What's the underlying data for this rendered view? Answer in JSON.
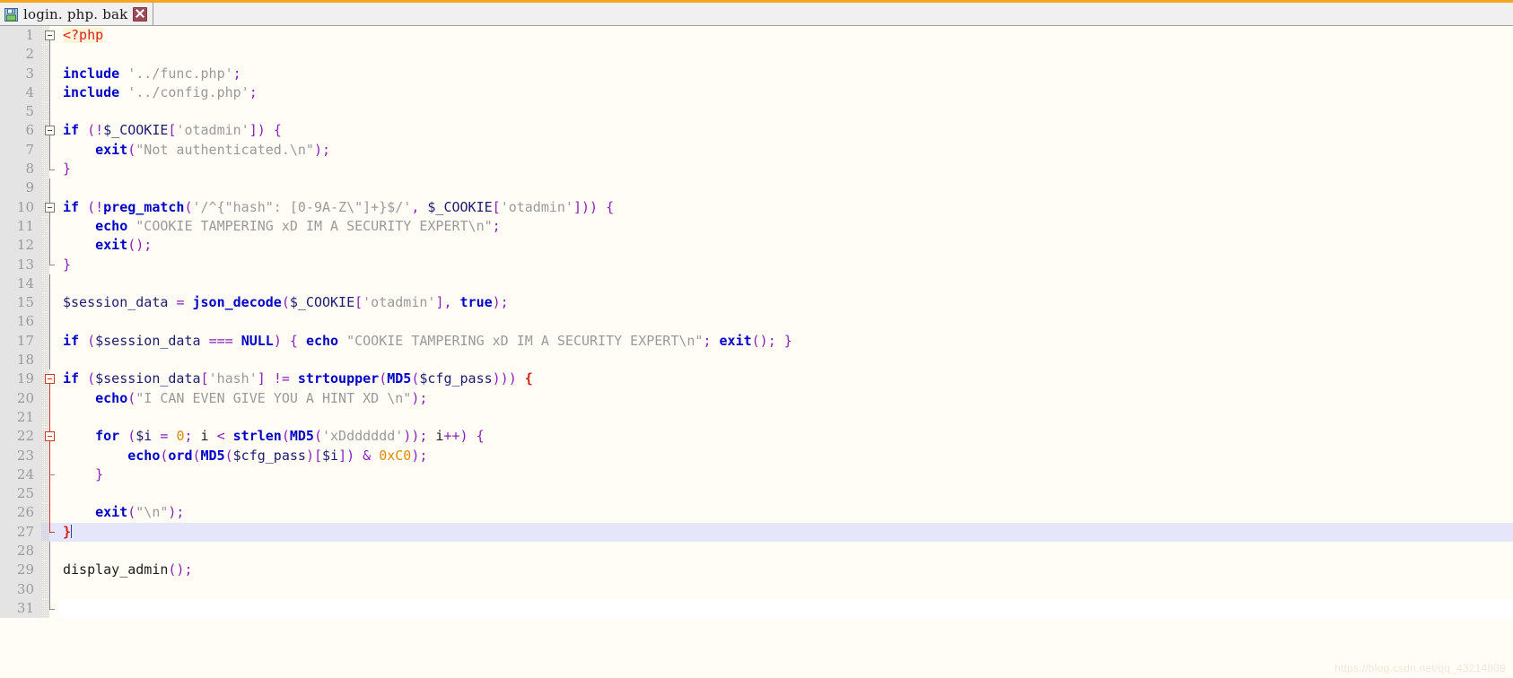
{
  "window": {
    "accent_color": "#f5a623",
    "editor_background": "#fffdf5",
    "gutter_background": "#e4e4e4",
    "current_line_highlight": "#e6e6fa"
  },
  "tab": {
    "title": "login. php. bak",
    "save_icon": "floppy-disk-icon",
    "close_icon": "close-icon"
  },
  "gutter": {
    "line_numbers": [
      "1",
      "2",
      "3",
      "4",
      "5",
      "6",
      "7",
      "8",
      "9",
      "10",
      "11",
      "12",
      "13",
      "14",
      "15",
      "16",
      "17",
      "18",
      "19",
      "20",
      "21",
      "22",
      "23",
      "24",
      "25",
      "26",
      "27",
      "28",
      "29",
      "30",
      "31"
    ]
  },
  "code": {
    "lines": [
      {
        "n": "1",
        "text": "<?php"
      },
      {
        "n": "2",
        "text": ""
      },
      {
        "n": "3",
        "text": "include '../func.php';"
      },
      {
        "n": "4",
        "text": "include '../config.php';"
      },
      {
        "n": "5",
        "text": ""
      },
      {
        "n": "6",
        "text": "if (!$_COOKIE['otadmin']) {"
      },
      {
        "n": "7",
        "text": "    exit(\"Not authenticated.\\n\");"
      },
      {
        "n": "8",
        "text": "}"
      },
      {
        "n": "9",
        "text": ""
      },
      {
        "n": "10",
        "text": "if (!preg_match('/^{\"hash\": [0-9A-Z\\\"]+}$/', $_COOKIE['otadmin'])) {"
      },
      {
        "n": "11",
        "text": "    echo \"COOKIE TAMPERING xD IM A SECURITY EXPERT\\n\";"
      },
      {
        "n": "12",
        "text": "    exit();"
      },
      {
        "n": "13",
        "text": "}"
      },
      {
        "n": "14",
        "text": ""
      },
      {
        "n": "15",
        "text": "$session_data = json_decode($_COOKIE['otadmin'], true);"
      },
      {
        "n": "16",
        "text": ""
      },
      {
        "n": "17",
        "text": "if ($session_data === NULL) { echo \"COOKIE TAMPERING xD IM A SECURITY EXPERT\\n\"; exit(); }"
      },
      {
        "n": "18",
        "text": ""
      },
      {
        "n": "19",
        "text": "if ($session_data['hash'] != strtoupper(MD5($cfg_pass))) {"
      },
      {
        "n": "20",
        "text": "    echo(\"I CAN EVEN GIVE YOU A HINT XD \\n\");"
      },
      {
        "n": "21",
        "text": ""
      },
      {
        "n": "22",
        "text": "    for ($i = 0; i < strlen(MD5('xDdddddd')); i++) {"
      },
      {
        "n": "23",
        "text": "        echo(ord(MD5($cfg_pass)[$i]) & 0xC0);"
      },
      {
        "n": "24",
        "text": "    }"
      },
      {
        "n": "25",
        "text": ""
      },
      {
        "n": "26",
        "text": "    exit(\"\\n\");"
      },
      {
        "n": "27",
        "text": "}"
      },
      {
        "n": "28",
        "text": ""
      },
      {
        "n": "29",
        "text": "display_admin();"
      },
      {
        "n": "30",
        "text": ""
      },
      {
        "n": "31",
        "text": ""
      }
    ],
    "current_line": "27",
    "language": "php"
  },
  "watermark": {
    "text": "https://blog.csdn.net/qq_43214809"
  }
}
